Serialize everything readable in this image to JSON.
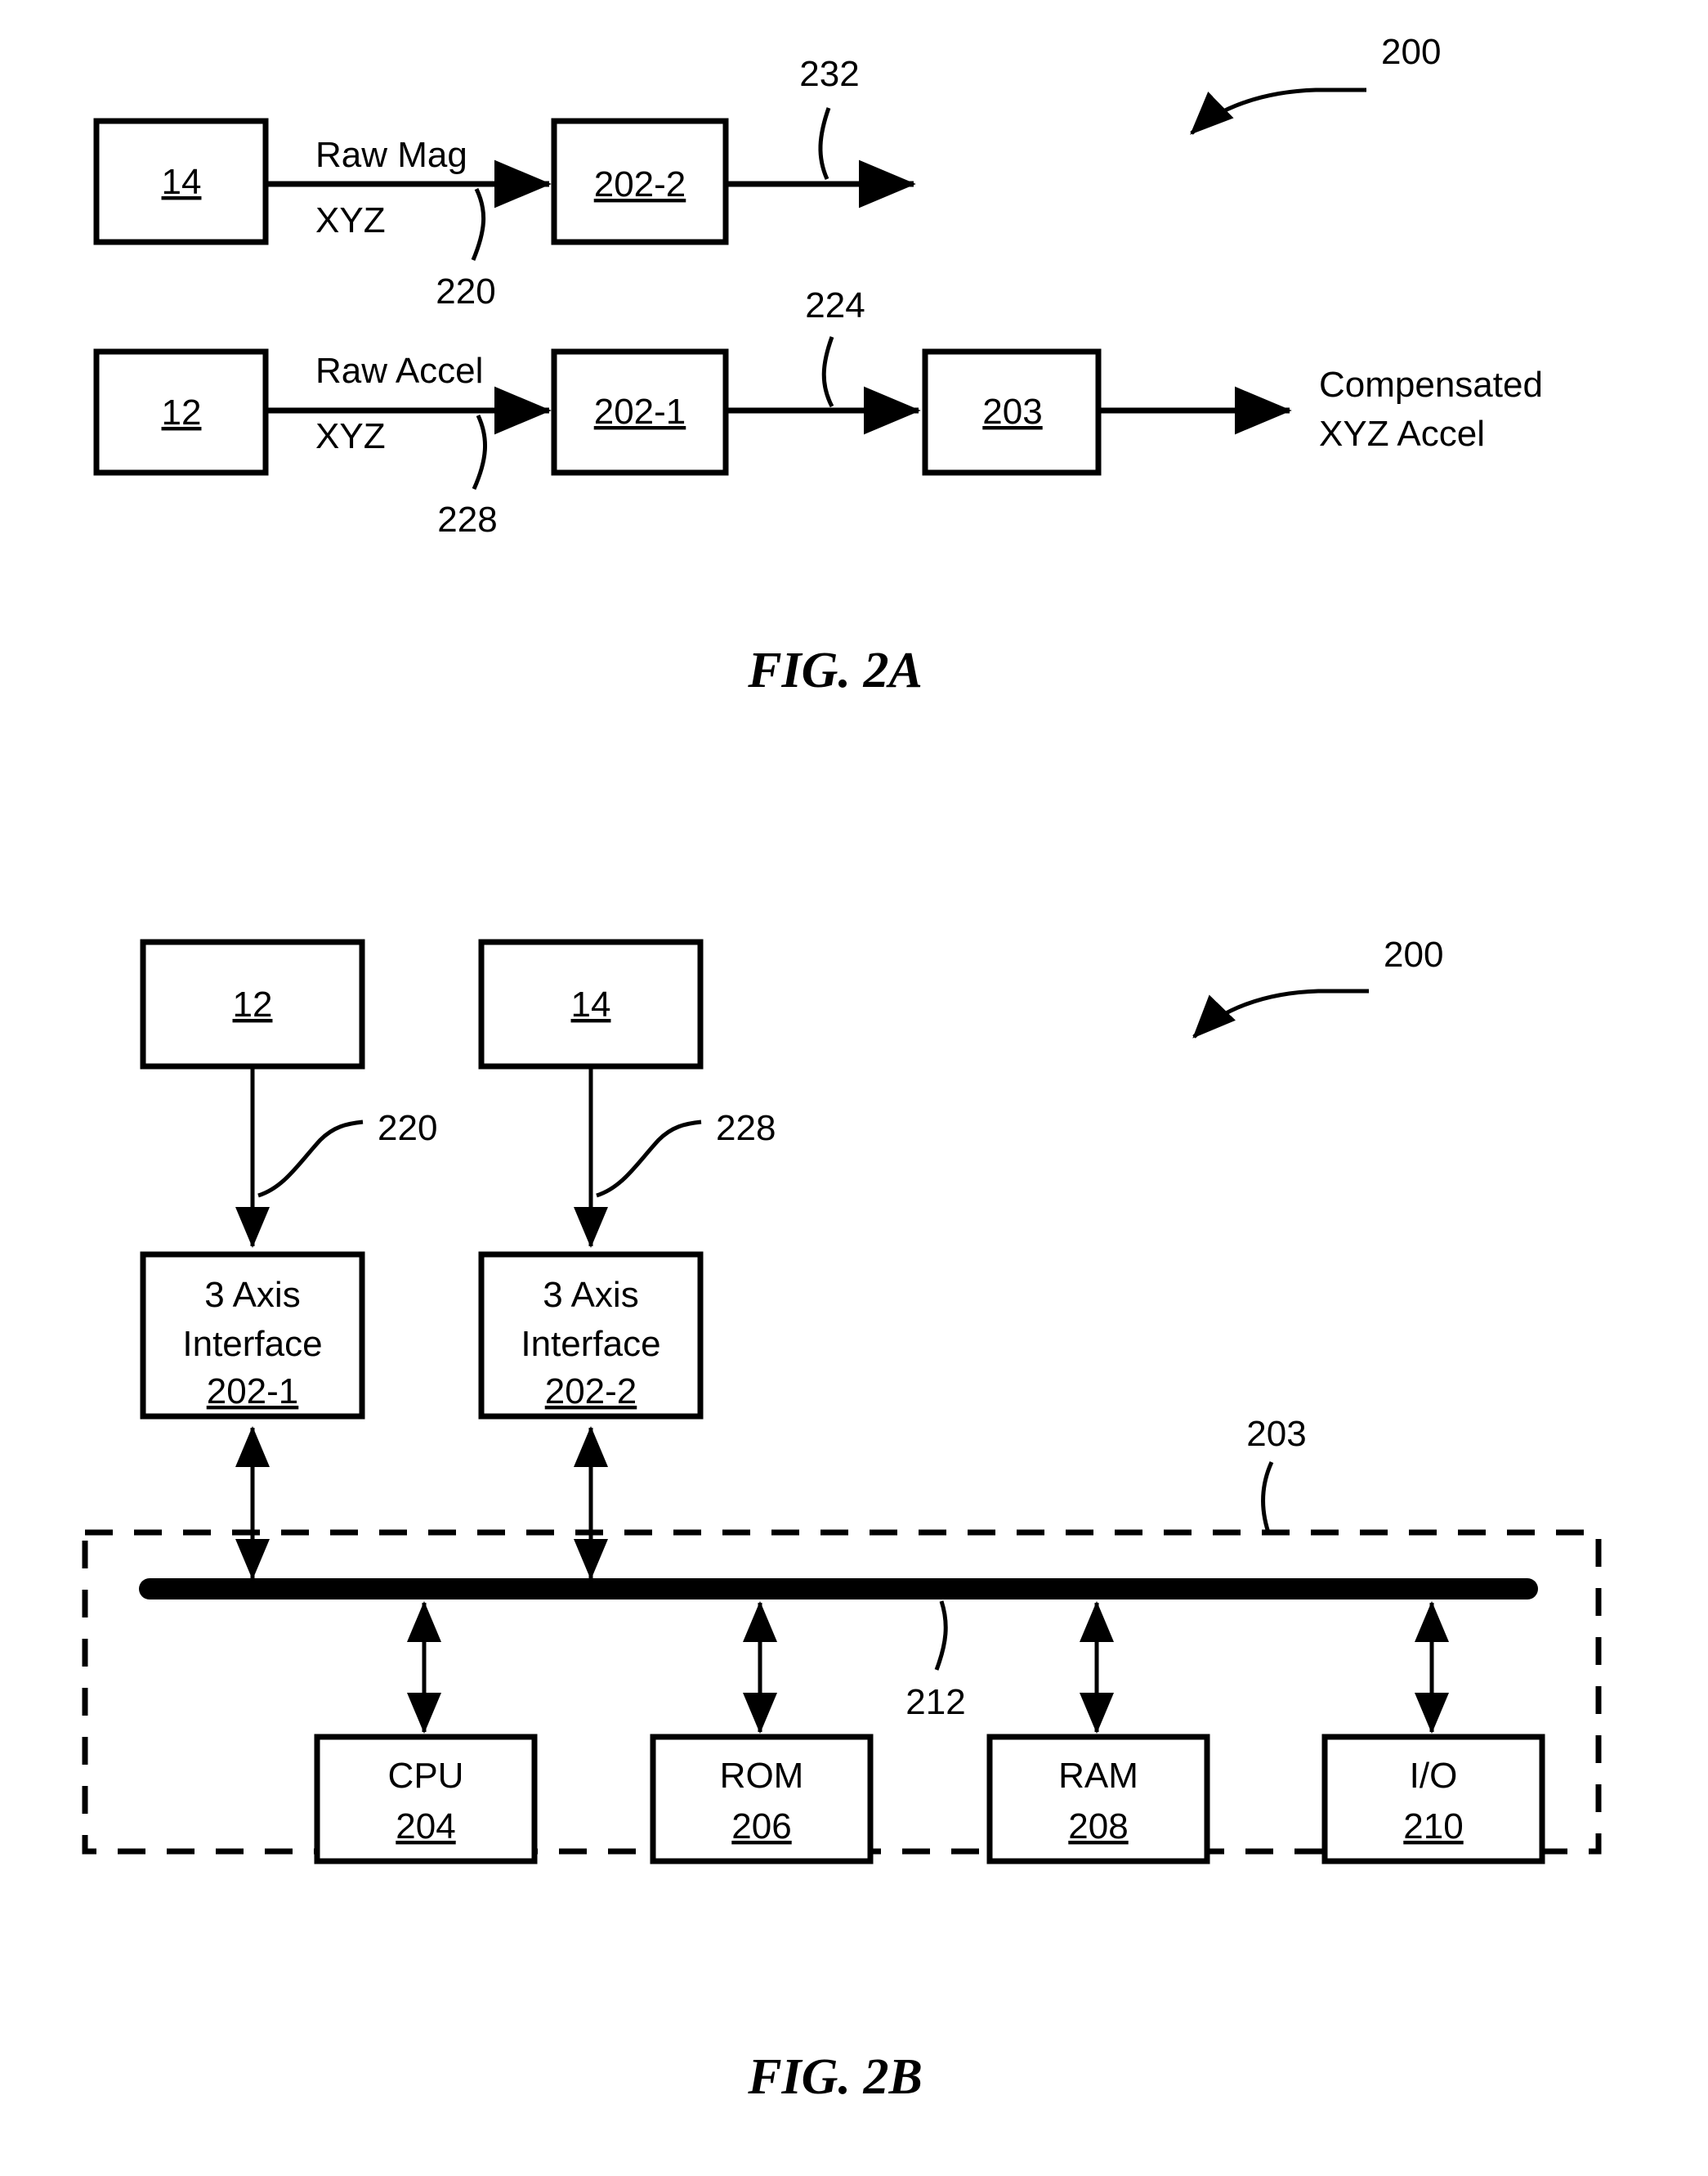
{
  "sheet": {
    "background": "#ffffff",
    "ink": "#000000"
  },
  "figures": [
    {
      "id": "fig-2a",
      "caption": "FIG. 2A",
      "system_ref": "200",
      "rows": [
        {
          "id": "mag-chain",
          "source_box": "14",
          "signal_label_line1": "Raw Mag",
          "signal_label_line2": "XYZ",
          "signal_ref": "220",
          "processor_box": "202-2",
          "output_ref": "232"
        },
        {
          "id": "accel-chain",
          "source_box": "12",
          "signal_label_line1": "Raw Accel",
          "signal_label_line2": "XYZ",
          "signal_ref": "228",
          "processor_box": "202-1",
          "intermediate_ref": "224",
          "controller_box": "203",
          "output_label_line1": "Compensated",
          "output_label_line2": "XYZ Accel"
        }
      ]
    },
    {
      "id": "fig-2b",
      "caption": "FIG. 2B",
      "system_ref": "200",
      "sensors": [
        {
          "id": "sensor-12",
          "ref": "12",
          "link_ref": "220"
        },
        {
          "id": "sensor-14",
          "ref": "14",
          "link_ref": "228"
        }
      ],
      "interfaces": [
        {
          "id": "interface-202-1",
          "title_line1": "3 Axis",
          "title_line2": "Interface",
          "ref": "202-1"
        },
        {
          "id": "interface-202-2",
          "title_line1": "3 Axis",
          "title_line2": "Interface",
          "ref": "202-2"
        }
      ],
      "controller": {
        "id": "controller-203",
        "ref": "203",
        "bus_ref": "212",
        "modules": [
          {
            "id": "module-cpu",
            "name": "CPU",
            "ref": "204"
          },
          {
            "id": "module-rom",
            "name": "ROM",
            "ref": "206"
          },
          {
            "id": "module-ram",
            "name": "RAM",
            "ref": "208"
          },
          {
            "id": "module-io",
            "name": "I/O",
            "ref": "210"
          }
        ]
      }
    }
  ]
}
